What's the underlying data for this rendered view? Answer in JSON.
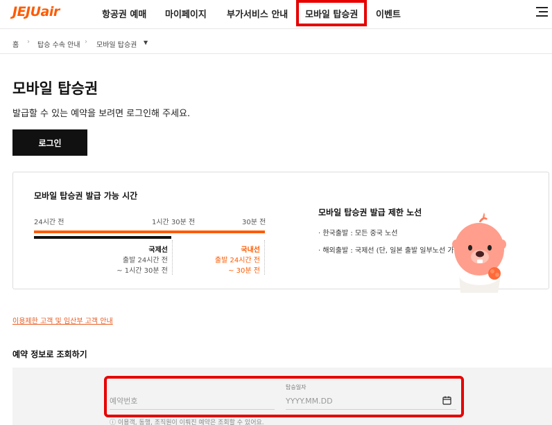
{
  "header": {
    "logo": "JEJUair",
    "nav": [
      "항공권 예매",
      "마이페이지",
      "부가서비스 안내",
      "모바일 탑승권",
      "이벤트"
    ]
  },
  "breadcrumb": {
    "home": "홈",
    "level1": "탑승 수속 안내",
    "level2": "모바일 탑승권"
  },
  "page": {
    "title": "모바일 탑승권",
    "description": "발급할 수 있는 예약을 보려면 로그인해 주세요.",
    "login_label": "로그인"
  },
  "issue_time": {
    "heading": "모바일 탑승권 발급 가능 시간",
    "labels": [
      "24시간 전",
      "1시간 30분 전",
      "30분 전"
    ],
    "international": {
      "title": "국제선",
      "line1": "출발 24시간 전",
      "line2": "~ 1시간 30분 전"
    },
    "domestic": {
      "title": "국내선",
      "line1": "출발 24시간 전",
      "line2": "~ 30분 전"
    }
  },
  "restrictions": {
    "heading": "모바일 탑승권 발급 제한 노선",
    "items": [
      "· 한국출발 : 모든 중국 노선",
      "· 해외출발 : 국제선 (단, 일본 출발 일부노선 가능)"
    ]
  },
  "notice_link": "이용제한 고객 및 임산부 고객 안내",
  "lookup": {
    "title": "예약 정보로 조회하기",
    "reservation_placeholder": "예약번호",
    "date_label": "탑승일자",
    "date_placeholder": "YYYY.MM.DD",
    "hint": "ⓘ 이용객, 동행, 조직원이 이뤄진 예약은 조회할 수 있어요."
  },
  "colors": {
    "brand": "#ff5a00",
    "highlight": "#e60000"
  }
}
